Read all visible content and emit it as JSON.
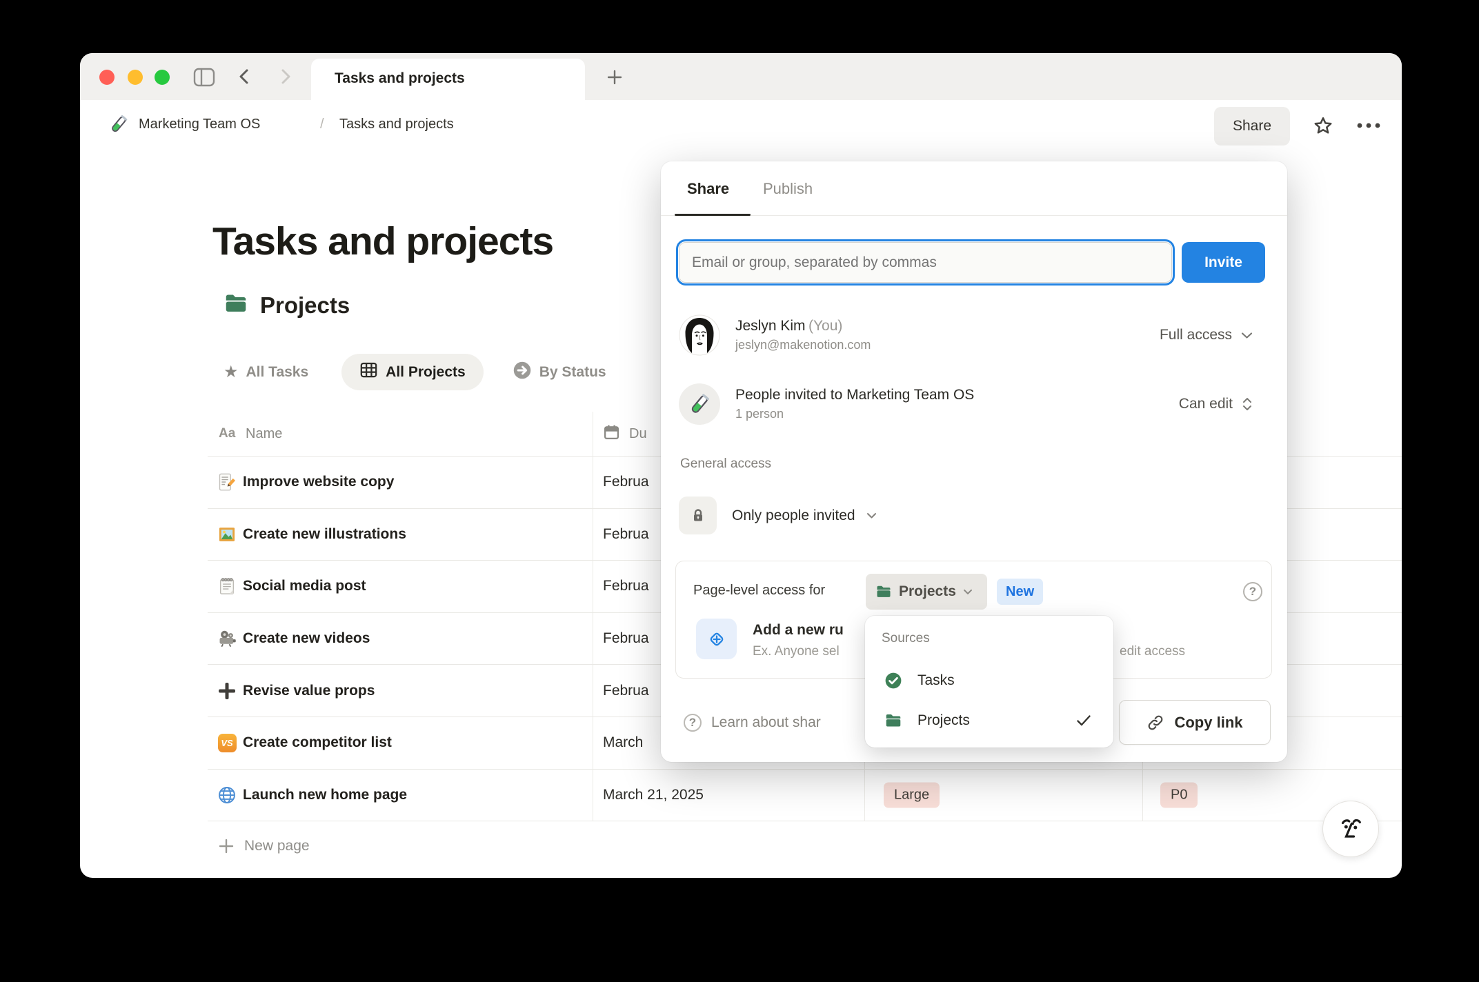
{
  "colors": {
    "accent_blue": "#2383e2",
    "folder_green": "#3f7e5c",
    "tag_pink_bg": "#f8ded8",
    "new_badge_bg": "#dfecfb",
    "new_badge_text": "#1f74e0",
    "traffic_red": "#ff5f56",
    "traffic_yellow": "#ffbd2e",
    "traffic_green": "#27c93f"
  },
  "window": {
    "tab": {
      "title": "Tasks and projects"
    },
    "breadcrumb": {
      "workspace": "Marketing Team OS",
      "separator": "/",
      "page": "Tasks and projects"
    },
    "actions": {
      "share_label": "Share"
    }
  },
  "page": {
    "title": "Tasks and projects",
    "collection_title": "Projects",
    "views": [
      {
        "label": "All Tasks"
      },
      {
        "label": "All Projects",
        "active": true
      },
      {
        "label": "By Status"
      }
    ],
    "table": {
      "name_column_icon": "Aa",
      "name_column": "Name",
      "due_column": "Du",
      "rows": [
        {
          "icon": "memo",
          "name": "Improve website copy",
          "due": "Februa"
        },
        {
          "icon": "framed-picture",
          "name": "Create new illustrations",
          "due": "Februa"
        },
        {
          "icon": "spiral-notepad",
          "name": "Social media post",
          "due": "Februa"
        },
        {
          "icon": "film-projector",
          "name": "Create new videos",
          "due": "Februa"
        },
        {
          "icon": "heavy-plus",
          "name": "Revise value props",
          "due": "Februa"
        },
        {
          "icon": "vs-badge",
          "name": "Create competitor list",
          "due": "March",
          "vs_text": "VS"
        },
        {
          "icon": "globe",
          "name": "Launch new home page",
          "due": "March 21, 2025",
          "size": "Large",
          "priority": "P0"
        }
      ],
      "new_page_label": "New page"
    }
  },
  "share_dialog": {
    "tabs": {
      "share": "Share",
      "publish": "Publish"
    },
    "invite": {
      "placeholder": "Email or group, separated by commas",
      "button": "Invite"
    },
    "members": [
      {
        "name": "Jeslyn Kim",
        "you": "(You)",
        "email": "jeslyn@makenotion.com",
        "access": "Full access"
      },
      {
        "name": "People invited to Marketing Team OS",
        "subtitle": "1 person",
        "access": "Can edit"
      }
    ],
    "general_access": {
      "heading": "General access",
      "value": "Only people invited"
    },
    "page_level": {
      "label": "Page-level access for",
      "chip": "Projects",
      "badge": "New",
      "rule_title": "Add a new ru",
      "rule_desc_left": "Ex. Anyone sel",
      "rule_desc_right": "edit access"
    },
    "sources_menu": {
      "heading": "Sources",
      "items": [
        {
          "label": "Tasks",
          "checked": false
        },
        {
          "label": "Projects",
          "checked": true
        }
      ]
    },
    "footer": {
      "learn": "Learn about shar",
      "copy_link": "Copy link"
    }
  }
}
